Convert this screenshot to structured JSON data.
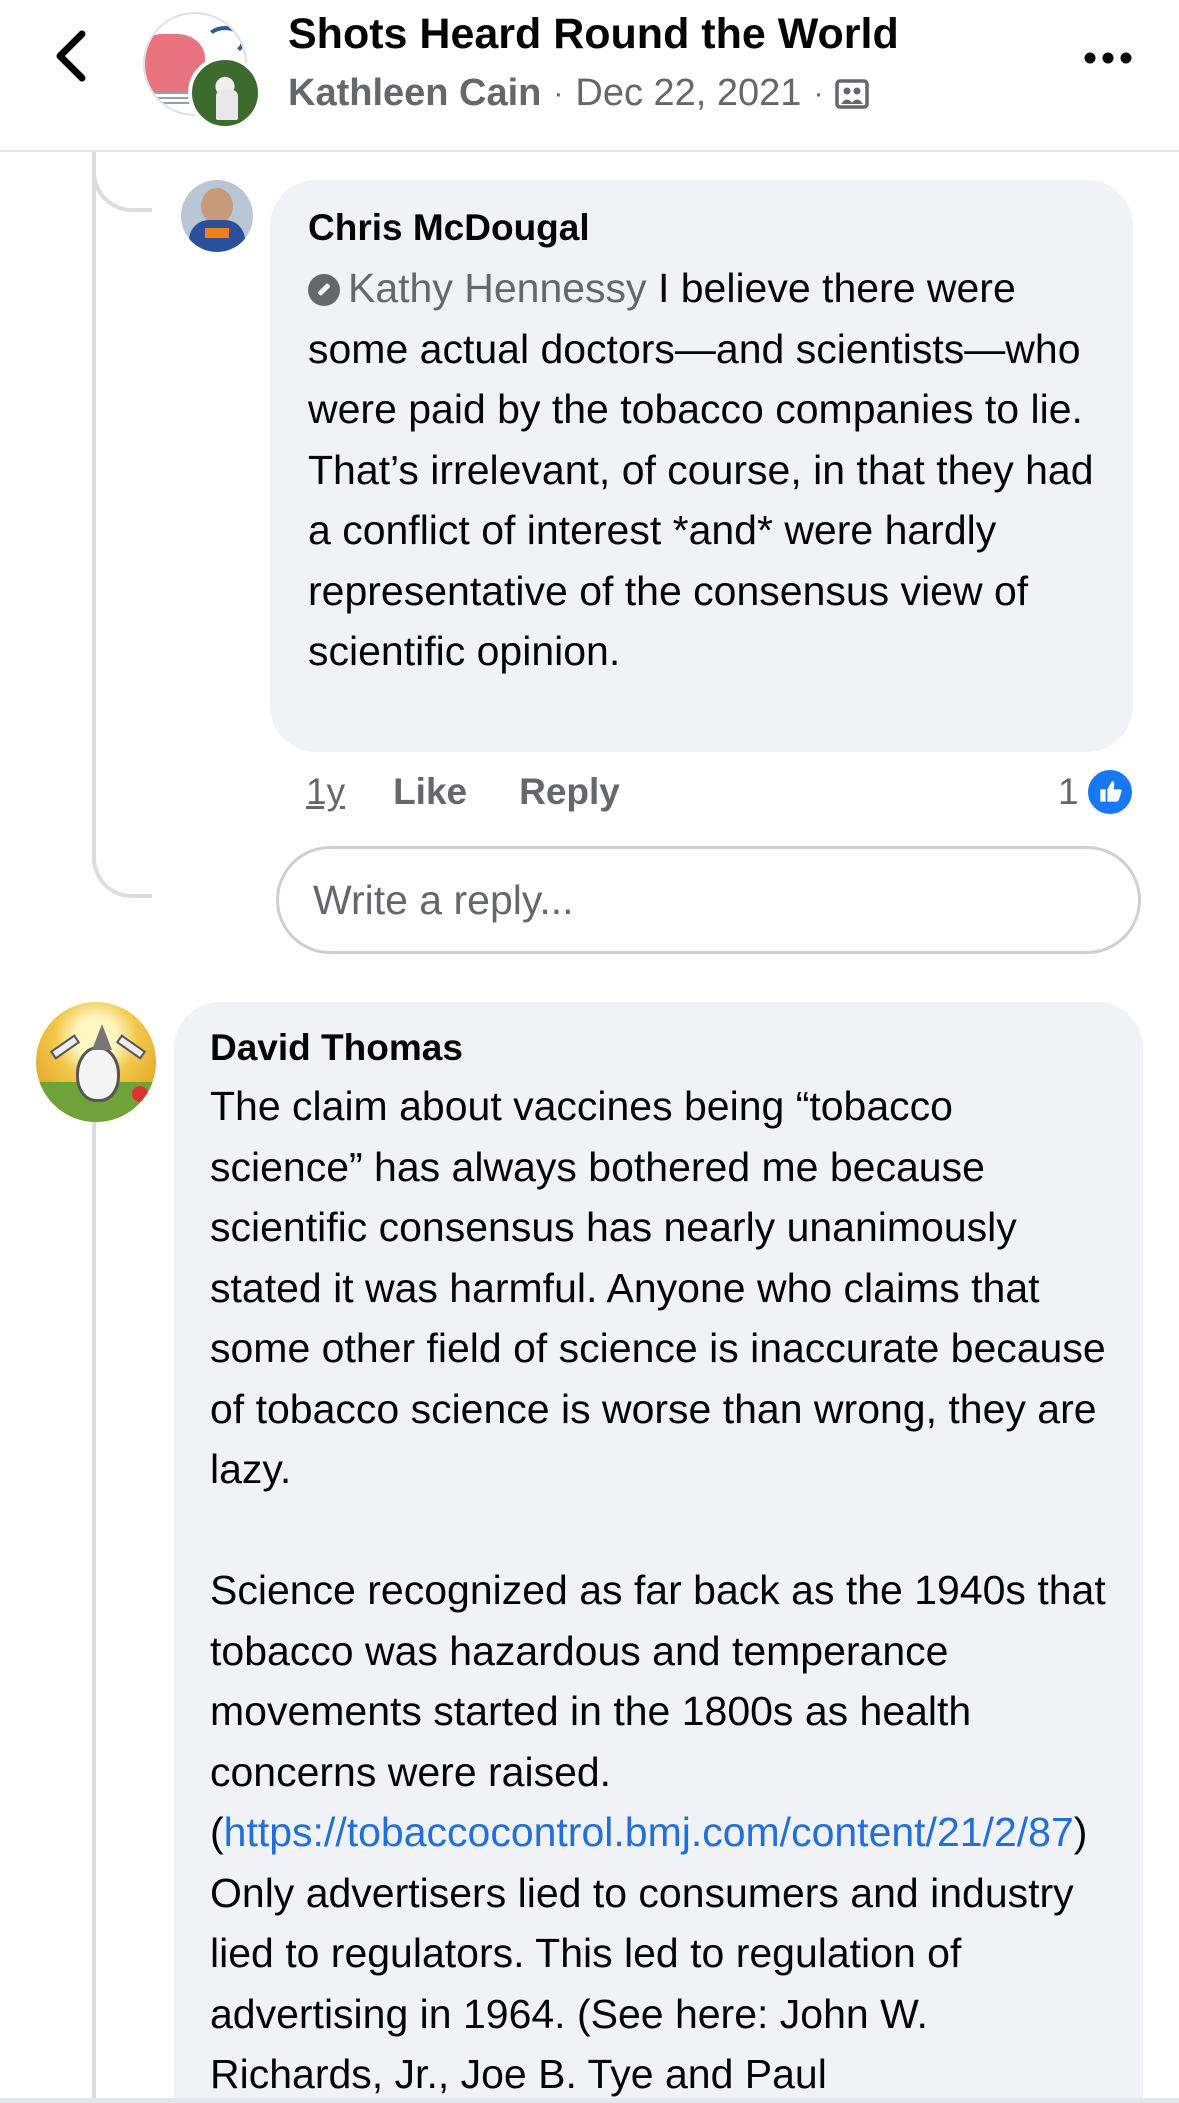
{
  "header": {
    "title": "Shots Heard Round the World",
    "author": "Kathleen Cain",
    "date": "Dec 22, 2021",
    "separator": "·",
    "back_icon": "chevron-left-icon",
    "more_icon": "more-horizontal-icon",
    "audience_icon": "group-icon"
  },
  "comment1": {
    "author": "Chris McDougal",
    "mention": "Kathy Hennessy",
    "body": " I believe there were some actual doctors—and scientists—who were paid by the tobacco companies to lie. That’s irrelevant, of course, in that they had a conflict of interest *and* were hardly representative of the consensus view of scientific opinion.",
    "time": "1y",
    "like_label": "Like",
    "reply_label": "Reply",
    "reaction_count": "1"
  },
  "reply_box": {
    "placeholder": "Write a reply..."
  },
  "comment2": {
    "author": "David Thomas",
    "para1": "The claim about vaccines being “tobacco science” has always bothered me because scientific consensus has nearly unanimously stated it was harmful. Anyone who claims that some other field of science is inaccurate because of tobacco science is worse than wrong, they are lazy.",
    "para2_start": "Science recognized as far back as the 1940s that tobacco was hazardous and temperance movements started in the 1800s as health concerns were raised. (",
    "link": "https://tobaccocontrol.bmj.com/content/21/2/87",
    "para2_end": ") Only advertisers lied to consumers and industry lied to regulators. This led to regulation of advertising in 1964. (See here: John W. Richards, Jr., Joe B. Tye and Paul"
  },
  "colors": {
    "accent": "#1877f2",
    "link": "#216fdb",
    "bubble": "#f0f2f5",
    "secondary_text": "#65676b"
  }
}
